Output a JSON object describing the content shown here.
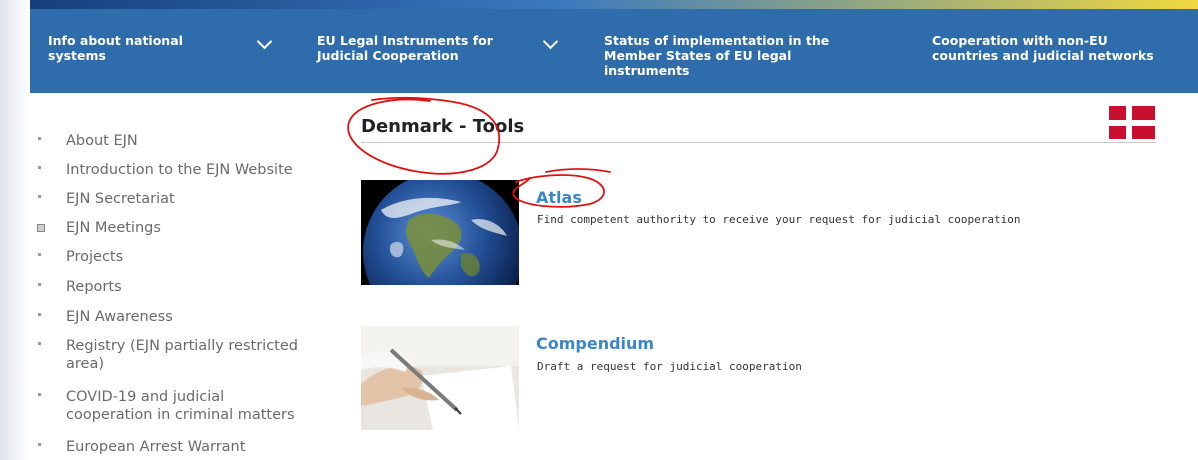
{
  "nav": {
    "items": [
      {
        "label_line1": "Info about national",
        "label_line2": "systems"
      },
      {
        "label_line1": "EU Legal Instruments for",
        "label_line2": "Judicial Cooperation"
      },
      {
        "label_line1": "Status of implementation in the",
        "label_line2": "Member States of EU legal",
        "label_line3": "instruments"
      },
      {
        "label_line1": "Cooperation with non-EU",
        "label_line2": "countries and judicial networks"
      }
    ]
  },
  "sidebar": {
    "items": [
      {
        "label": "About EJN"
      },
      {
        "label": "Introduction to the EJN Website"
      },
      {
        "label": "EJN Secretariat"
      },
      {
        "label": "EJN Meetings"
      },
      {
        "label": "Projects"
      },
      {
        "label": "Reports"
      },
      {
        "label": "EJN Awareness"
      },
      {
        "label_line1": "Registry (EJN partially restricted",
        "label_line2": "area)"
      },
      {
        "label_line1": "COVID-19 and judicial",
        "label_line2": "cooperation in criminal matters"
      },
      {
        "label": "European Arrest Warrant"
      }
    ]
  },
  "main": {
    "heading": "Denmark - Tools",
    "tools": [
      {
        "title": "Atlas",
        "description": "Find competent authority to receive your request for judicial cooperation",
        "icon": "earth-image"
      },
      {
        "title": "Compendium",
        "description": "Draft a request for judicial cooperation",
        "icon": "writing-hand-image"
      }
    ]
  },
  "colors": {
    "nav_bg": "#2e6cab",
    "link": "#3a86c8",
    "flag_red": "#c8102e",
    "annotation": "#e01010"
  }
}
